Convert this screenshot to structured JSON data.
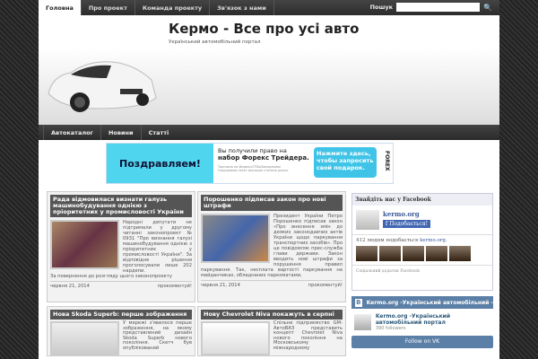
{
  "topnav": {
    "items": [
      "Головна",
      "Про проект",
      "Команда проекту",
      "Зв'язок з нами"
    ],
    "search_label": "Пошук",
    "search_value": ""
  },
  "header": {
    "title": "Кермо - Все про усі авто",
    "subtitle": "Український автомобільний портал"
  },
  "nav2": {
    "items": [
      "Автокаталог",
      "Новини",
      "Статті"
    ]
  },
  "banner": {
    "headline": "Поздравляем!",
    "line1": "Вы получили право на",
    "line2": "набор Форекс Трейдера.",
    "disclaimer": "Торговля на Форекс/CFDs/Бинарными Опционами несет высокую степень риска.",
    "cta": "Нажмите здесь, чтобы запросить свой подарок.",
    "brand": "FOREX"
  },
  "posts": [
    {
      "title": "Рада відмовилася визнати галузь машинобудування однією з пріоритетних у промисловості України",
      "text": "Народні депутати не підтримали у другому читанні законопроект № 0931 \"Про визнання галузі машинобудування однією з пріоритетних у промисловості України\". За відповідне рішення проголосували лише 202 нардепи.",
      "more": "За повернення до розгляду цього законопроекту",
      "date": "червня 21, 2014",
      "comment": "прокоментуй!"
    },
    {
      "title": "Порошенко підписав закон про нові штрафи",
      "text": "Президент України Петро Порошенко підписав закон «Про внесення змін до деяких законодавчих актів України щодо паркування транспортних засобів». Про це повідомляє прес-служба глави держави. Закон вводить нові штрафи за порушення правил паркування. Так, несплата вартості паркування на майданчиках, обладнаних паркоматами,",
      "more": "",
      "date": "червня 21, 2014",
      "comment": "прокоментуй!"
    },
    {
      "title": "Нова Skoda Superb: перше зображення",
      "text": "У мережі з'явилося перше зображення, на якому представлений дизайн Skoda Superb нового покоління. Скетч був опублікований"
    },
    {
      "title": "Нову Chevrolet Niva покажуть в серпні",
      "text": "Спільне підприємство GM-АвтоВАЗ представить концепт Chevrolet Niva нового покоління на Московському міжнародному"
    }
  ],
  "facebook": {
    "header": "Знайдіть нас у Facebook",
    "page": "kermo.org",
    "like": "Подобається!",
    "count_text": "412 людям подобається",
    "count_link": "kermo.org.",
    "footer": "Соціальний додаток Facebook"
  },
  "vk": {
    "bar": "Kermo.org -Український автомобільний -",
    "group": "Kermo.org -Український автомобільний портал",
    "followers": "390 followers",
    "button": "Follow on VK"
  }
}
